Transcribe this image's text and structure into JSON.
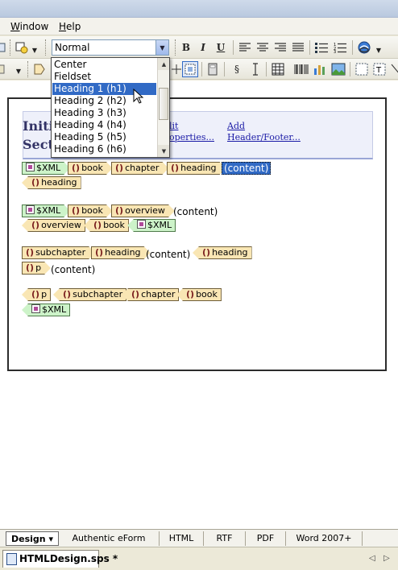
{
  "menubar": {
    "items": [
      {
        "label": "Window",
        "accel": "W",
        "rest": "indow"
      },
      {
        "label": "Help",
        "accel": "H",
        "rest": "elp"
      }
    ]
  },
  "toolbar": {
    "style_combo_value": "Normal",
    "bold_label": "B",
    "italic_label": "I",
    "underline_label": "U"
  },
  "style_dropdown": {
    "options": [
      "Center",
      "Fieldset",
      "Heading 1 (h1)",
      "Heading 2 (h2)",
      "Heading 3 (h3)",
      "Heading 4 (h4)",
      "Heading 5 (h5)",
      "Heading 6 (h6)"
    ],
    "selected": "Heading 1 (h1)"
  },
  "document": {
    "title_partial": "Initi Sect",
    "title_line1": "Initi",
    "title_line2": "Sect",
    "header_links": {
      "edit_partial": "lit",
      "properties_partial": "operties...",
      "add": "Add",
      "header_footer": "Header/Footer..."
    },
    "design_tags": {
      "row1": [
        "$XML",
        "book",
        "chapter",
        "heading"
      ],
      "row1_content": "(content)",
      "row2": [
        "heading"
      ],
      "row3": [
        "$XML",
        "book",
        "overview"
      ],
      "row3_content": "(content)",
      "row4": [
        "overview",
        "book",
        "$XML"
      ],
      "row5": [
        "subchapter",
        "heading"
      ],
      "row5_content": "(content)",
      "row5_end": "heading",
      "row6": [
        "p"
      ],
      "row6_content": "(content)",
      "row7": [
        "p",
        "subchapter",
        "chapter",
        "book"
      ],
      "row8": [
        "$XML"
      ]
    }
  },
  "view_tabs": {
    "design": "Design ▾",
    "authentic": "Authentic eForm",
    "html": "HTML",
    "rtf": "RTF",
    "pdf": "PDF",
    "word": "Word 2007+"
  },
  "file_tab": {
    "label": "HTMLDesign.sps *"
  }
}
